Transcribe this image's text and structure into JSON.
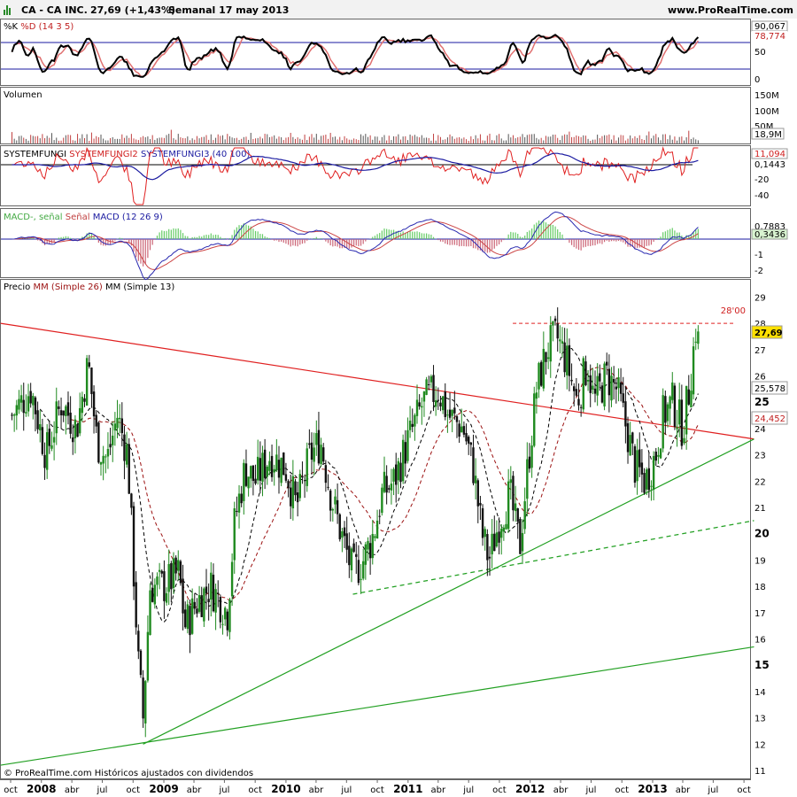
{
  "header": {
    "icon": "bar-chart-icon",
    "symbol": "CA - CA INC.",
    "price": "27,69 (+1,43%)",
    "period": "Semanal  17 may 2013",
    "site": "www.ProRealTime.com"
  },
  "footer": "© ProRealTime.com  Históricos ajustados con dividendos",
  "colors": {
    "up": "#1f8a1f",
    "down": "#111111",
    "ma26": "#9b1010",
    "ma13": "#000000",
    "res": "#e02020",
    "sup": "#22a022",
    "macdPos": "#66cc66",
    "macdNeg": "#cc6677"
  },
  "panels": {
    "stoch": {
      "title1": "%K",
      "title2": "%D (14 3 5)",
      "ticks": [
        "50",
        "0"
      ],
      "last_k": "90,067",
      "last_d": "78,774"
    },
    "volume": {
      "title": "Volumen",
      "ticks": [
        "150M",
        "100M",
        "50M"
      ],
      "last": "18,9M"
    },
    "sysfungi": {
      "t1": "SYSTEMFUNGI",
      "t2": "SYSTEMFUNGI2",
      "t3": "SYSTEMFUNGI3 (40 100)",
      "ticks": [
        "-20",
        "-40"
      ],
      "last1": "11,094",
      "last2": "0,1443"
    },
    "macd": {
      "t1": "MACD-, señal",
      "t2": "Señal",
      "t3": "MACD (12 26 9)",
      "ticks": [
        "-1",
        "-2"
      ],
      "last1": "0,7883",
      "last2": "0,3436"
    },
    "price": {
      "t1": "Precio",
      "t2": "MM (Simple 26)",
      "t3": "MM (Simple 13)",
      "ticks": [
        "29",
        "28",
        "27",
        "26",
        "25",
        "24",
        "23",
        "22",
        "21",
        "20",
        "19",
        "18",
        "17",
        "16",
        "15",
        "14",
        "13",
        "12",
        "11"
      ],
      "last": "27,69",
      "mm26": "25,578",
      "mm13": "24,452",
      "resistance_label": "28'00"
    }
  },
  "x_axis": [
    "oct",
    "2008",
    "abr",
    "jul",
    "oct",
    "2009",
    "abr",
    "jul",
    "oct",
    "2010",
    "abr",
    "jul",
    "oct",
    "2011",
    "abr",
    "jul",
    "oct",
    "2012",
    "abr",
    "jul",
    "oct",
    "2013",
    "abr",
    "jul",
    "oct"
  ],
  "chart_data": {
    "type": "candlestick",
    "title": "CA - CA INC.",
    "period": "Semanal",
    "ylim": [
      11,
      29.5
    ],
    "resistance_level": 28.0,
    "anchors": [
      [
        "2007-10-05",
        24.5
      ],
      [
        "2007-12-01",
        25.5
      ],
      [
        "2008-01-15",
        23.0
      ],
      [
        "2008-03-01",
        25.0
      ],
      [
        "2008-04-15",
        24.0
      ],
      [
        "2008-05-20",
        26.5
      ],
      [
        "2008-06-15",
        23.5
      ],
      [
        "2008-07-15",
        22.8
      ],
      [
        "2008-08-15",
        24.5
      ],
      [
        "2008-09-15",
        23.0
      ],
      [
        "2008-10-17",
        15.0
      ],
      [
        "2008-10-31",
        13.0
      ],
      [
        "2008-11-21",
        18.0
      ],
      [
        "2008-12-31",
        18.0
      ],
      [
        "2009-02-15",
        18.5
      ],
      [
        "2009-03-05",
        16.5
      ],
      [
        "2009-04-15",
        17.5
      ],
      [
        "2009-05-20",
        18.0
      ],
      [
        "2009-07-10",
        17.0
      ],
      [
        "2009-08-01",
        20.5
      ],
      [
        "2009-09-01",
        22.5
      ],
      [
        "2009-10-01",
        22.0
      ],
      [
        "2009-11-15",
        23.0
      ],
      [
        "2009-12-31",
        22.5
      ],
      [
        "2010-02-01",
        21.0
      ],
      [
        "2010-03-15",
        23.0
      ],
      [
        "2010-04-15",
        23.5
      ],
      [
        "2010-05-15",
        21.5
      ],
      [
        "2010-06-15",
        20.0
      ],
      [
        "2010-07-20",
        18.5
      ],
      [
        "2010-08-20",
        19.0
      ],
      [
        "2010-09-20",
        20.0
      ],
      [
        "2010-10-15",
        21.5
      ],
      [
        "2010-11-20",
        22.0
      ],
      [
        "2010-12-31",
        23.5
      ],
      [
        "2011-02-15",
        25.0
      ],
      [
        "2011-04-01",
        25.5
      ],
      [
        "2011-05-01",
        24.5
      ],
      [
        "2011-06-15",
        24.0
      ],
      [
        "2011-07-15",
        22.5
      ],
      [
        "2011-08-10",
        20.0
      ],
      [
        "2011-08-31",
        19.0
      ],
      [
        "2011-10-01",
        20.5
      ],
      [
        "2011-11-01",
        21.5
      ],
      [
        "2011-12-01",
        19.5
      ],
      [
        "2011-12-20",
        22.0
      ],
      [
        "2012-01-20",
        25.5
      ],
      [
        "2012-02-20",
        27.0
      ],
      [
        "2012-03-20",
        27.5
      ],
      [
        "2012-04-20",
        26.5
      ],
      [
        "2012-05-20",
        25.0
      ],
      [
        "2012-06-20",
        26.5
      ],
      [
        "2012-07-10",
        25.0
      ],
      [
        "2012-08-15",
        26.0
      ],
      [
        "2012-09-15",
        25.5
      ],
      [
        "2012-10-15",
        24.0
      ],
      [
        "2012-11-10",
        22.5
      ],
      [
        "2012-12-10",
        22.0
      ],
      [
        "2013-01-10",
        23.0
      ],
      [
        "2013-02-01",
        24.5
      ],
      [
        "2013-03-01",
        25.0
      ],
      [
        "2013-04-01",
        24.0
      ],
      [
        "2013-04-20",
        25.5
      ],
      [
        "2013-05-10",
        27.8
      ],
      [
        "2013-05-17",
        27.69
      ]
    ],
    "moving_averages": [
      {
        "name": "MM (Simple 26)",
        "period": 26,
        "last": 25.578
      },
      {
        "name": "MM (Simple 13)",
        "period": 13,
        "last": 24.452
      }
    ],
    "trendlines": [
      {
        "name": "resistance",
        "color": "red",
        "points": [
          [
            "2007-09-01",
            28.0
          ],
          [
            "2013-10-31",
            23.6
          ]
        ]
      },
      {
        "name": "support",
        "color": "green",
        "points": [
          [
            "2008-10-31",
            12.0
          ],
          [
            "2013-10-31",
            23.6
          ]
        ]
      },
      {
        "name": "support-dashed",
        "color": "green",
        "dashed": true,
        "points": [
          [
            "2010-07-20",
            17.7
          ],
          [
            "2013-10-31",
            20.5
          ]
        ]
      },
      {
        "name": "long-support",
        "color": "green",
        "points": [
          [
            "2007-09-01",
            11.2
          ],
          [
            "2013-10-31",
            15.7
          ]
        ]
      }
    ],
    "stochastic": {
      "k_last": 90.067,
      "d_last": 78.774,
      "levels": [
        80,
        20
      ]
    },
    "volume_last": "18,9M",
    "macd_last": {
      "macd": 0.7883,
      "signal": 0.3436
    }
  }
}
